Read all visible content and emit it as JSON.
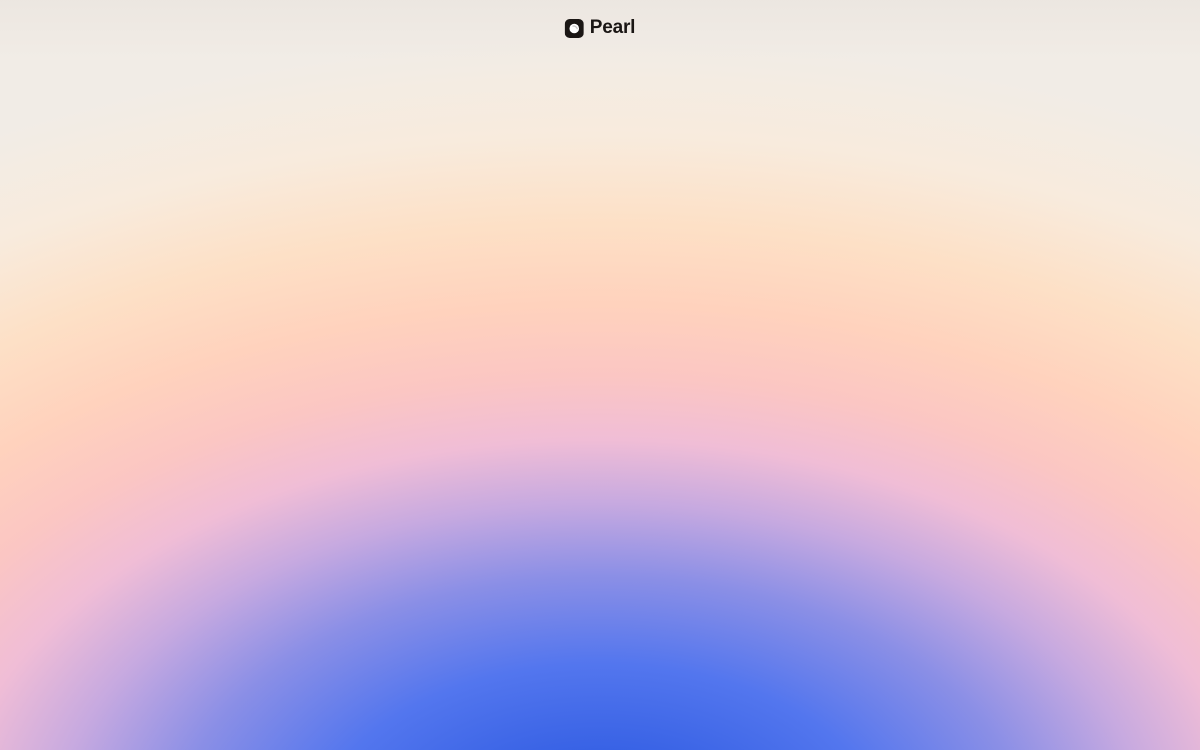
{
  "app": {
    "name": "Pearl",
    "logo_icon": "pearl-logo-icon"
  },
  "theme": {
    "text_color": "#1a1614",
    "gradient_colors": [
      "#2a55d2",
      "#5376ee",
      "#c6a9e0",
      "#f0bdd6",
      "#ffd2bd",
      "#f1ece6"
    ]
  }
}
